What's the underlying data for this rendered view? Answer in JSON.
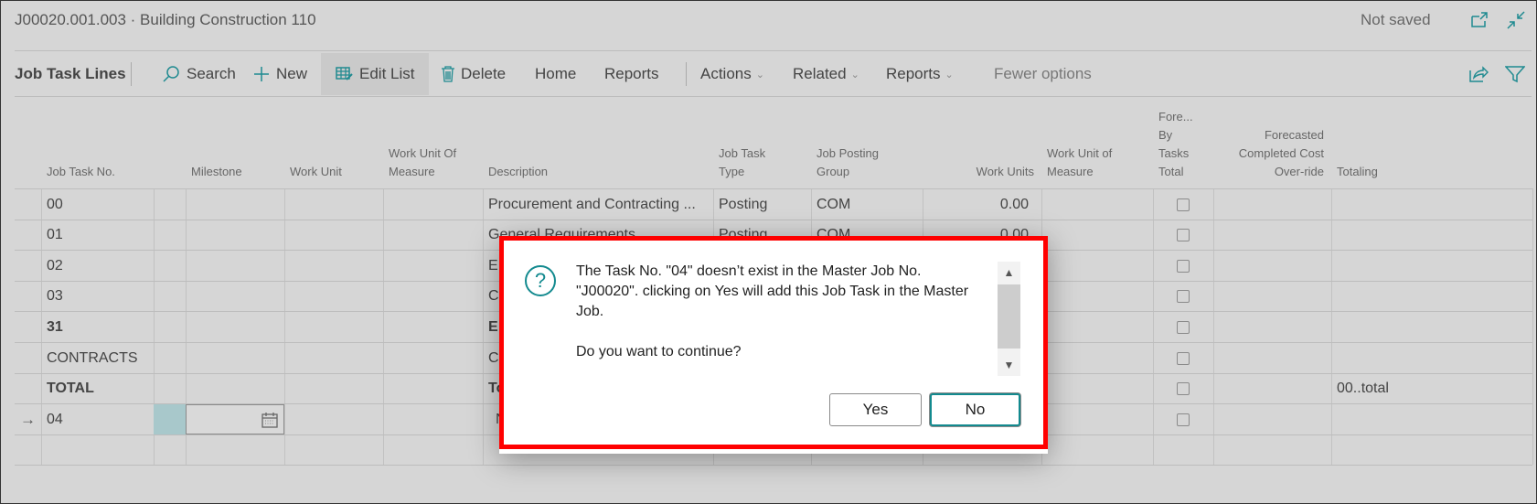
{
  "header": {
    "title": "J00020.001.003 · Building Construction 110",
    "status": "Not saved",
    "icons": [
      "open-in-new-window-icon",
      "collapse-icon"
    ]
  },
  "toolbar": {
    "page_label": "Job Task Lines",
    "search": "Search",
    "new": "New",
    "edit_list": "Edit List",
    "delete": "Delete",
    "home": "Home",
    "reports": "Reports",
    "actions": "Actions",
    "related": "Related",
    "reports_menu": "Reports",
    "fewer_options": "Fewer options",
    "right_icons": [
      "share-icon",
      "filter-icon"
    ]
  },
  "columns": [
    {
      "key": "job_task_no",
      "label_lines": [
        "Job Task No."
      ]
    },
    {
      "key": "milestone",
      "label_lines": [
        "Milestone"
      ]
    },
    {
      "key": "work_unit",
      "label_lines": [
        "Work Unit"
      ]
    },
    {
      "key": "work_unit_of_measure",
      "label_lines": [
        "Work Unit Of",
        "Measure"
      ]
    },
    {
      "key": "description",
      "label_lines": [
        "Description"
      ]
    },
    {
      "key": "job_task_type",
      "label_lines": [
        "Job Task",
        "Type"
      ]
    },
    {
      "key": "job_posting_group",
      "label_lines": [
        "Job Posting",
        "Group"
      ]
    },
    {
      "key": "work_units",
      "label_lines": [
        "Work Units"
      ]
    },
    {
      "key": "work_unit_of_measure_2",
      "label_lines": [
        "Work Unit of",
        "Measure"
      ]
    },
    {
      "key": "fore_by_tasks_total",
      "label_lines": [
        "Fore...",
        "By",
        "Tasks",
        "Total"
      ]
    },
    {
      "key": "forecasted_completed_cost_override",
      "label_lines": [
        "Forecasted",
        "Completed Cost",
        "Over-ride"
      ]
    },
    {
      "key": "totaling",
      "label_lines": [
        "Totaling"
      ]
    }
  ],
  "rows": [
    {
      "job_task_no": "00",
      "description": "Procurement and Contracting ...",
      "job_task_type": "Posting",
      "job_posting_group": "COM",
      "work_units": "0.00",
      "fore_checked": false,
      "totaling": "",
      "bold": false,
      "current": false
    },
    {
      "job_task_no": "01",
      "description": "General Requirements",
      "job_task_type": "Posting",
      "job_posting_group": "COM",
      "work_units": "0.00",
      "fore_checked": false,
      "totaling": "",
      "bold": false,
      "current": false
    },
    {
      "job_task_no": "02",
      "description": "E",
      "job_task_type": "",
      "job_posting_group": "",
      "work_units": "",
      "fore_checked": false,
      "totaling": "",
      "bold": false,
      "current": false
    },
    {
      "job_task_no": "03",
      "description": "C",
      "job_task_type": "",
      "job_posting_group": "",
      "work_units": "",
      "fore_checked": false,
      "totaling": "",
      "bold": false,
      "current": false
    },
    {
      "job_task_no": "31",
      "description": "E",
      "job_task_type": "",
      "job_posting_group": "",
      "work_units": "",
      "fore_checked": false,
      "totaling": "",
      "bold": true,
      "current": false
    },
    {
      "job_task_no": "CONTRACTS",
      "description": "C",
      "job_task_type": "",
      "job_posting_group": "",
      "work_units": "",
      "fore_checked": false,
      "totaling": "",
      "bold": false,
      "current": false
    },
    {
      "job_task_no": "TOTAL",
      "description": "To",
      "job_task_type": "",
      "job_posting_group": "",
      "work_units": "",
      "fore_checked": false,
      "totaling": "00..total",
      "bold": true,
      "current": false
    },
    {
      "job_task_no": "04",
      "description": "N",
      "job_task_type": "",
      "job_posting_group": "",
      "work_units": "",
      "fore_checked": false,
      "totaling": "",
      "bold": false,
      "current": true
    }
  ],
  "dialog": {
    "icon": "question-icon",
    "message": "The Task No. \"04\" doesn’t exist in the Master Job No. \"J00020\". clicking on Yes will add this Job Task in the Master Job.",
    "question": "Do you want to continue?",
    "yes_label": "Yes",
    "no_label": "No",
    "highlight_color": "#ff0000",
    "accent_color": "#138a8f"
  }
}
